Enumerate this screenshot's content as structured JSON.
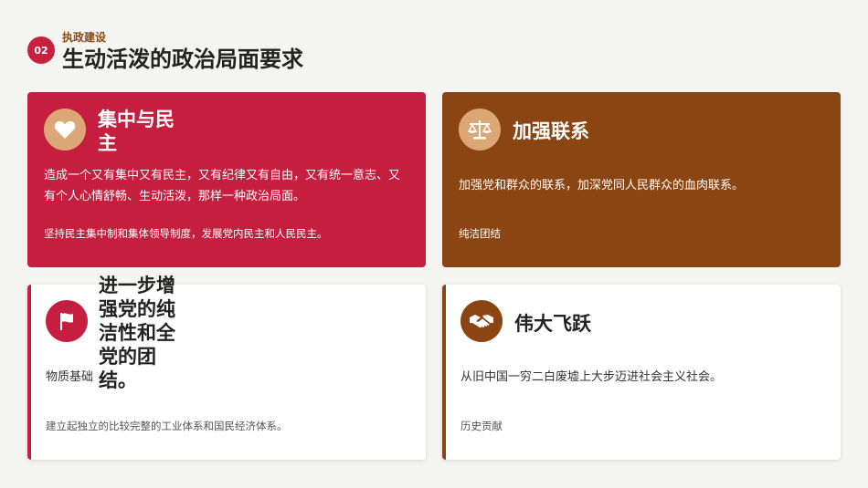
{
  "header": {
    "badge": "02",
    "eyebrow": "执政建设",
    "title": "生动活泼的政治局面要求"
  },
  "cards": [
    {
      "title": "集中与民主",
      "body": "造成一个又有集中又有民主，又有纪律又有自由，又有统一意志、又有个人心情舒畅、生动活泼，那样一种政治局面。",
      "foot": "坚持民主集中制和集体领导制度，发展党内民主和人民民主。",
      "icon": "heart-icon"
    },
    {
      "title": "加强联系",
      "body": "加强党和群众的联系，加深党同人民群众的血肉联系。",
      "foot": "纯洁团结",
      "icon": "balance-scale-icon"
    },
    {
      "title": "进一步增强党的纯洁性和全党的团结。",
      "body": "物质基础",
      "foot": "建立起独立的比较完整的工业体系和国民经济体系。",
      "icon": "flag-icon"
    },
    {
      "title": "伟大飞跃",
      "body": "从旧中国一穷二白废墟上大步迈进社会主义社会。",
      "foot": "历史贡献",
      "icon": "handshake-icon"
    }
  ],
  "colors": {
    "red": "#c61e3e",
    "brown": "#8b4512",
    "tan": "#dba776"
  }
}
